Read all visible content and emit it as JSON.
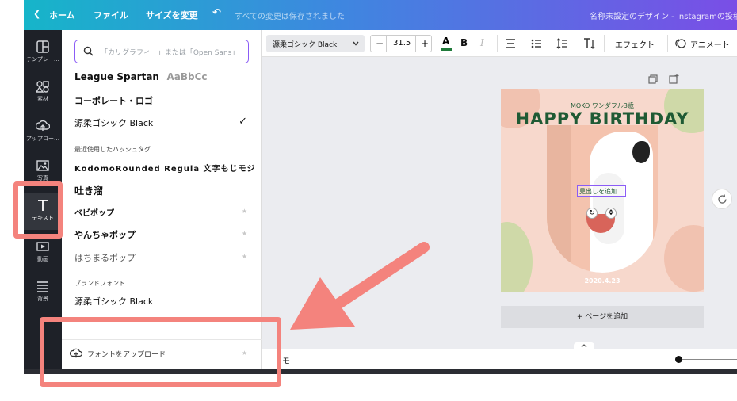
{
  "topbar": {
    "back_label": "ホーム",
    "file_label": "ファイル",
    "resize_label": "サイズを変更",
    "saved_status": "すべての変更は保存されました",
    "doc_title": "名称未設定のデザイン - Instagramの投稿"
  },
  "rail": {
    "items": [
      {
        "label": "テンプレー…",
        "icon": "template-icon"
      },
      {
        "label": "素材",
        "icon": "elements-icon"
      },
      {
        "label": "アップロー…",
        "icon": "upload-icon"
      },
      {
        "label": "写真",
        "icon": "photo-icon"
      },
      {
        "label": "テキスト",
        "icon": "text-icon"
      },
      {
        "label": "動画",
        "icon": "video-icon"
      },
      {
        "label": "背景",
        "icon": "background-icon"
      }
    ]
  },
  "panel": {
    "search_placeholder": "「カリグラフィー」または「Open Sans」",
    "fonts_top": [
      {
        "name": "League Spartan",
        "sample": "AaBbCc"
      },
      {
        "name": "コーポレート・ロゴ"
      },
      {
        "name": "源柔ゴシック Black",
        "checked": "✓"
      }
    ],
    "recent_header": "最近使用したハッシュタグ",
    "recent_fonts": [
      "KodomoRounded Regula 文字もじモジ",
      "吐き溜",
      "ベビポップ",
      "やんちゃポップ",
      "はちまるポップ"
    ],
    "brand_header": "ブランドフォント",
    "brand_font": "源柔ゴシック Black",
    "upload_font_label": "フォントをアップロード",
    "star": "★"
  },
  "toolbar": {
    "font_select": "源柔ゴシック Black",
    "font_size": "31.5",
    "minus": "−",
    "plus": "+",
    "color_glyph": "A",
    "bold_glyph": "B",
    "italic_glyph": "I",
    "effects_label": "エフェクト",
    "animate_label": "アニメート"
  },
  "design": {
    "subtitle": "MOKO ワンダフル3歳",
    "title": "HAPPY BIRTHDAY",
    "selected_text": "見出しを追加",
    "date": "2020.4.23"
  },
  "canvas": {
    "add_page_label": "+ ページを追加"
  },
  "bottombar": {
    "notes_label": "モ"
  }
}
